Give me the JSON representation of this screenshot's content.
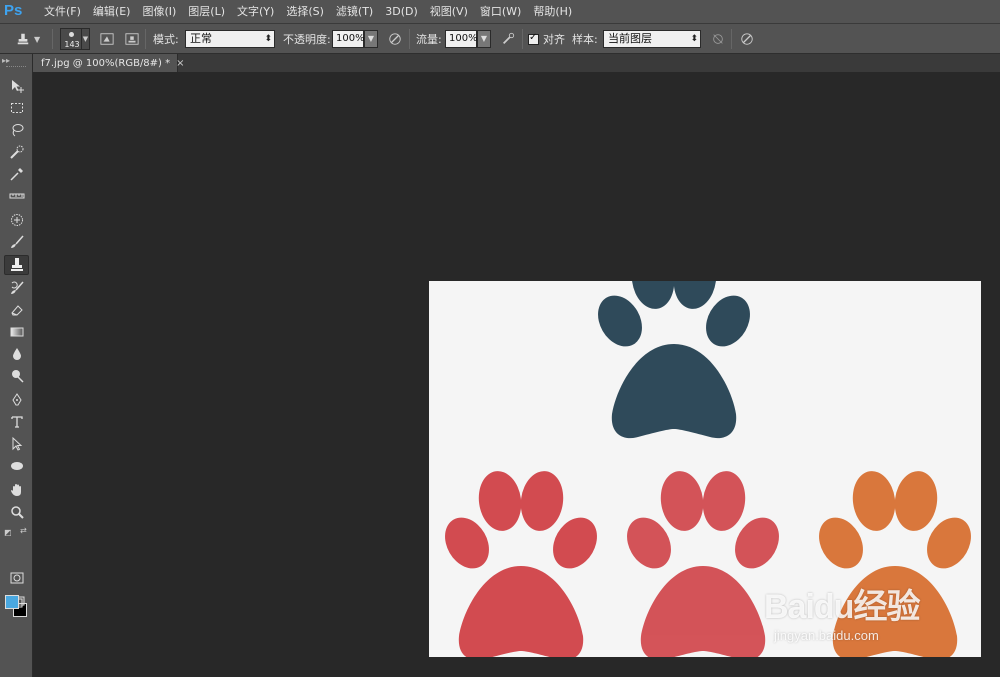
{
  "app": {
    "logo": "Ps"
  },
  "menu": [
    "文件(F)",
    "编辑(E)",
    "图像(I)",
    "图层(L)",
    "文字(Y)",
    "选择(S)",
    "滤镜(T)",
    "3D(D)",
    "视图(V)",
    "窗口(W)",
    "帮助(H)"
  ],
  "options": {
    "brush_size": "143",
    "mode_label": "模式:",
    "mode_value": "正常",
    "opacity_label": "不透明度:",
    "opacity_value": "100%",
    "flow_label": "流量:",
    "flow_value": "100%",
    "aligned_label": "对齐",
    "aligned_checked": true,
    "sample_label": "样本:",
    "sample_value": "当前图层"
  },
  "document": {
    "tab_title": "f7.jpg @ 100%(RGB/8#) *",
    "close_glyph": "×"
  },
  "colors": {
    "foreground": "#4aa8e0",
    "background": "#000000",
    "paw_dark": "#2f4a5a",
    "paw_red": "#d24b50",
    "paw_orange": "#d9773c"
  },
  "watermark": {
    "main": "Baidu经验",
    "sub": "jingyan.baidu.com"
  }
}
